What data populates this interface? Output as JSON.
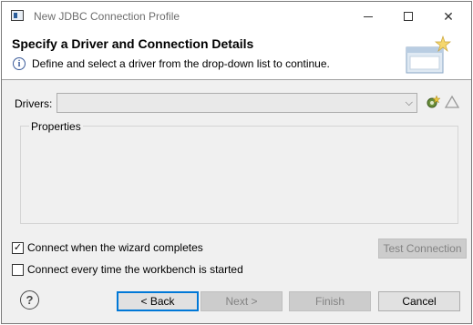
{
  "window": {
    "title": "New JDBC Connection Profile",
    "controls": {
      "minimize_icon": "minimize-icon",
      "maximize_icon": "maximize-icon",
      "close_glyph": "✕"
    }
  },
  "banner": {
    "title": "Specify a Driver and Connection Details",
    "info_glyph": "i",
    "message": "Define and select a driver from the drop-down list to continue."
  },
  "drivers": {
    "label": "Drivers:",
    "selected_value": "",
    "dropdown_glyph": "⌵"
  },
  "properties": {
    "label": "Properties"
  },
  "options": {
    "connect_when_complete": {
      "label": "Connect when the wizard completes",
      "checked": true,
      "mark": "✓"
    },
    "connect_every_time": {
      "label": "Connect every time the workbench is started",
      "checked": false,
      "mark": ""
    }
  },
  "buttons": {
    "test_connection": "Test Connection",
    "back": "< Back",
    "next": "Next >",
    "finish": "Finish",
    "cancel": "Cancel",
    "help_glyph": "?"
  },
  "colors": {
    "focus_border": "#0078d7",
    "disabled_text": "#838383",
    "dialog_bg": "#f0f0f0"
  }
}
